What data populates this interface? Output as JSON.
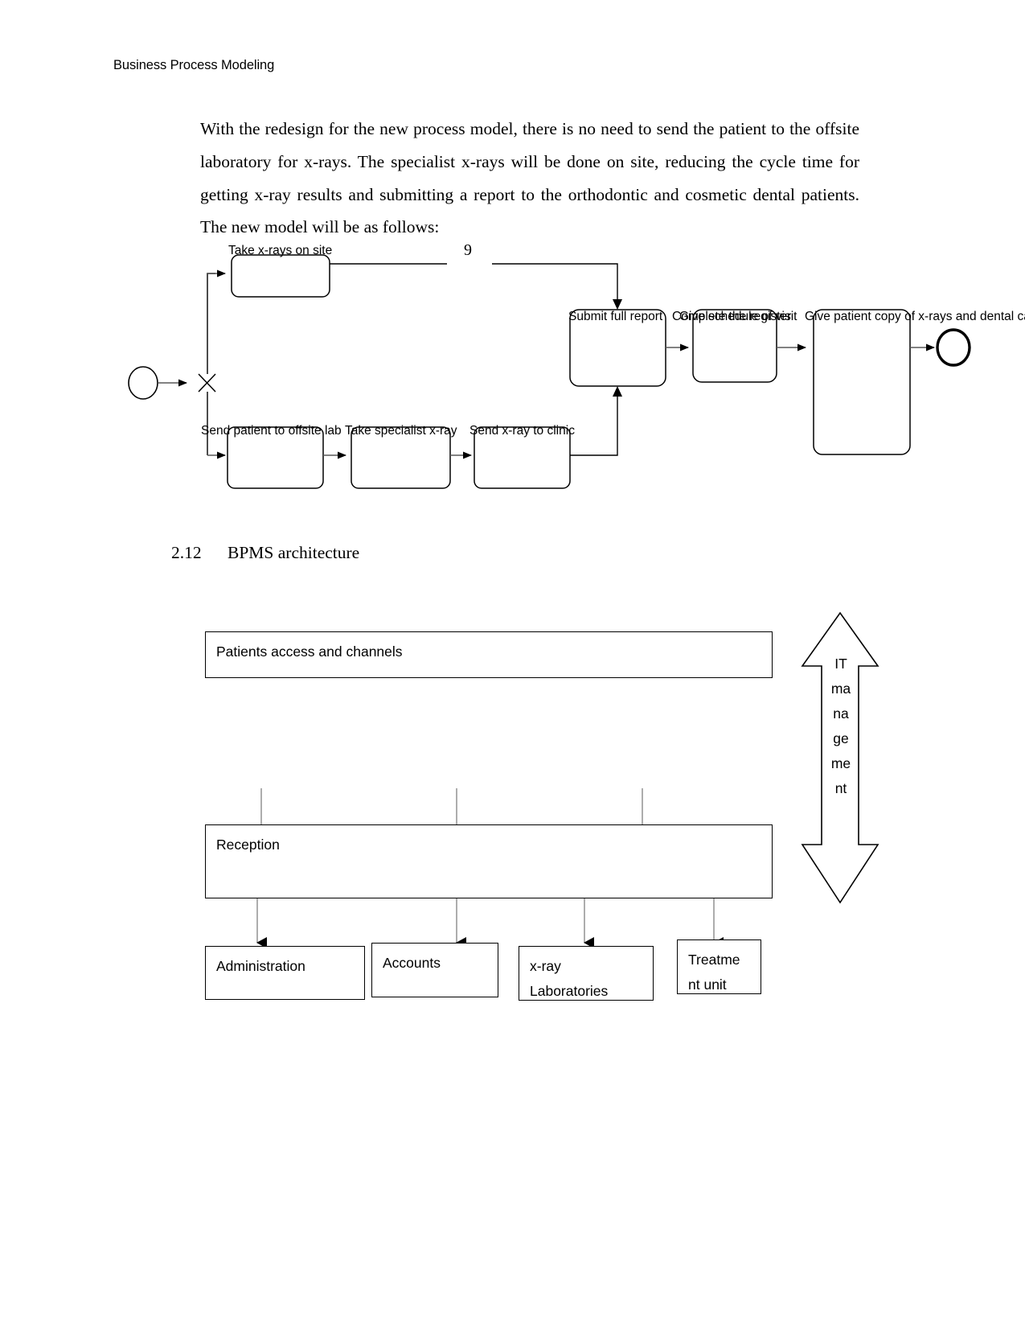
{
  "document": {
    "running_head": "Business Process Modeling",
    "page_number": "9",
    "paragraph": "With the redesign for the new process model, there is no need to send the patient to the offsite laboratory for x-rays. The specialist x-rays will be done on site, reducing the cycle time for getting x-ray results and submitting a report to the orthodontic and cosmetic dental patients. The new model will be as follows:",
    "section": {
      "number": "2.12",
      "title": "BPMS architecture"
    }
  },
  "bpmn_diagram": {
    "name": "new-process-model",
    "start_event_label": "",
    "gateway_label": "",
    "tasks": [
      {
        "id": "take-xrays-on-site",
        "label": "Take x-rays on site"
      },
      {
        "id": "send-patient-offsite-lab",
        "label": "Send patient to offsite lab"
      },
      {
        "id": "take-specialist-xray",
        "label": "Take specialist x-ray"
      },
      {
        "id": "send-xray-to-clinic",
        "label": "Send x-ray to clinic"
      },
      {
        "id": "submit-full-report",
        "label": "Submit full report"
      },
      {
        "id": "complete-the-register",
        "label": "Complete the register"
      },
      {
        "id": "give-schedule-of-visit",
        "label": "Give schedule of visit"
      },
      {
        "id": "give-patient-copy-xrays",
        "label": "Give patient copy of x-rays and dental care"
      }
    ]
  },
  "architecture_diagram": {
    "name": "bpms-architecture",
    "top_layer": {
      "id": "patients-access-and-channels",
      "label": "Patients access and channels"
    },
    "middle_layer": {
      "id": "reception",
      "label": "Reception"
    },
    "bottom_layer": [
      {
        "id": "administration",
        "label": "Administration"
      },
      {
        "id": "accounts",
        "label": "Accounts"
      },
      {
        "id": "x-ray-laboratories",
        "label": "x-ray\nLaboratories"
      },
      {
        "id": "treatment-unit",
        "label": "Treatme\nnt unit"
      }
    ],
    "side_arrow": {
      "id": "it-management",
      "label": "IT\nma\nna\nge\nme\nnt"
    }
  },
  "colors": {
    "ink": "#000000",
    "page": "#ffffff",
    "connector": "#595959"
  }
}
